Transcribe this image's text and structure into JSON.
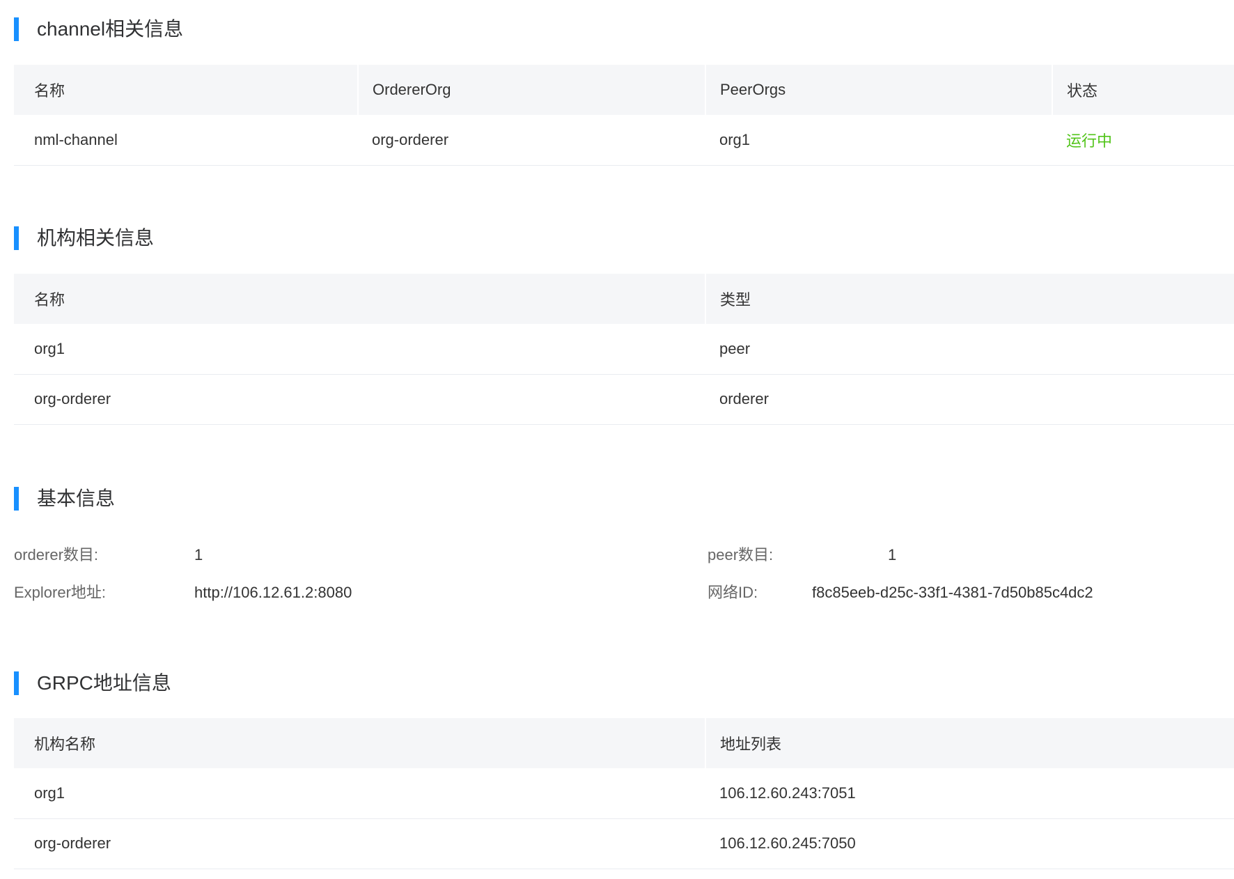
{
  "colors": {
    "accent": "#1890ff",
    "status_running": "#52c41a",
    "header_bg": "#f5f6f8"
  },
  "channel_section": {
    "title": "channel相关信息",
    "columns": {
      "name": "名称",
      "orderer_org": "OrdererOrg",
      "peer_orgs": "PeerOrgs",
      "status": "状态"
    },
    "rows": [
      {
        "name": "nml-channel",
        "orderer_org": "org-orderer",
        "peer_orgs": "org1",
        "status": "运行中"
      }
    ]
  },
  "org_section": {
    "title": "机构相关信息",
    "columns": {
      "name": "名称",
      "type": "类型"
    },
    "rows": [
      {
        "name": "org1",
        "type": "peer"
      },
      {
        "name": "org-orderer",
        "type": "orderer"
      }
    ]
  },
  "basic_section": {
    "title": "基本信息",
    "orderer_count": {
      "label": "orderer数目:",
      "value": "1"
    },
    "peer_count": {
      "label": "peer数目:",
      "value": "1"
    },
    "explorer_address": {
      "label": "Explorer地址:",
      "value": "http://106.12.61.2:8080"
    },
    "network_id": {
      "label": "网络ID:",
      "value": "f8c85eeb-d25c-33f1-4381-7d50b85c4dc2"
    }
  },
  "grpc_section": {
    "title": "GRPC地址信息",
    "columns": {
      "org_name": "机构名称",
      "addresses": "地址列表"
    },
    "rows": [
      {
        "org_name": "org1",
        "addresses": "106.12.60.243:7051"
      },
      {
        "org_name": "org-orderer",
        "addresses": "106.12.60.245:7050"
      }
    ]
  }
}
